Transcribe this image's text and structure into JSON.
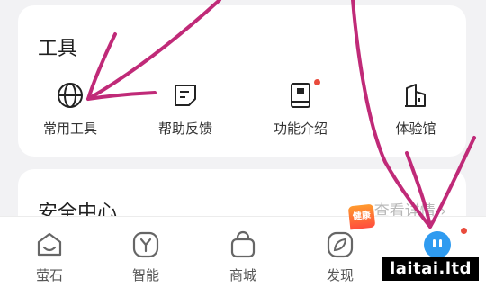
{
  "tools_section": {
    "title": "工具",
    "items": [
      {
        "label": "常用工具",
        "icon": "globe-icon"
      },
      {
        "label": "帮助反馈",
        "icon": "feedback-note-icon"
      },
      {
        "label": "功能介绍",
        "icon": "book-icon"
      },
      {
        "label": "体验馆",
        "icon": "building-icon"
      }
    ]
  },
  "security_section": {
    "title": "安全中心",
    "link": "查看详情"
  },
  "tabbar": {
    "items": [
      {
        "label": "萤石",
        "icon": "home-icon"
      },
      {
        "label": "智能",
        "icon": "smart-y-icon"
      },
      {
        "label": "商城",
        "icon": "shopping-bag-icon"
      },
      {
        "label": "发现",
        "icon": "discover-leaf-icon"
      },
      {
        "label": "",
        "icon": "avatar-face-icon"
      }
    ],
    "badge": "健康"
  },
  "watermark": "laitai.ltd",
  "colors": {
    "accent_red": "#e94b3c",
    "avatar_blue": "#2f9bf0",
    "annotation_pink": "#c02a78"
  }
}
